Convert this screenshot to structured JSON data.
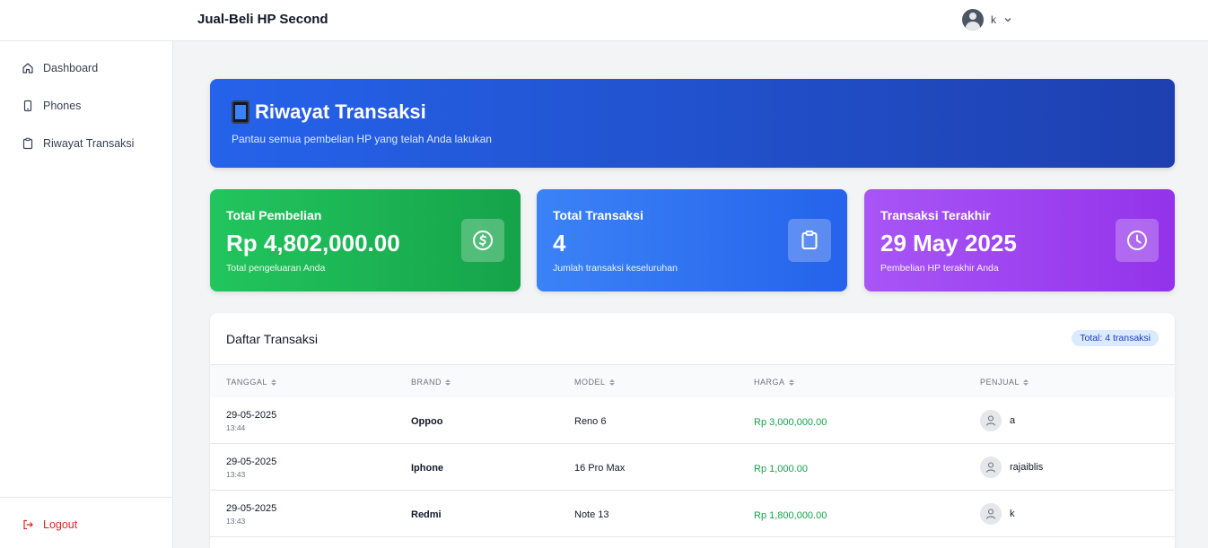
{
  "app": {
    "title": "Jual-Beli HP Second"
  },
  "user": {
    "name": "k"
  },
  "sidebar": {
    "items": [
      {
        "label": "Dashboard",
        "icon": "home-icon"
      },
      {
        "label": "Phones",
        "icon": "phone-icon"
      },
      {
        "label": "Riwayat Transaksi",
        "icon": "clipboard-icon"
      }
    ],
    "logout_label": "Logout"
  },
  "banner": {
    "title": "Riwayat Transaksi",
    "subtitle": "Pantau semua pembelian HP yang telah Anda lakukan"
  },
  "stats": [
    {
      "label": "Total Pembelian",
      "value": "Rp 4,802,000.00",
      "desc": "Total pengeluaran Anda",
      "icon": "dollar-icon",
      "color": "#22c55e"
    },
    {
      "label": "Total Transaksi",
      "value": "4",
      "desc": "Jumlah transaksi keseluruhan",
      "icon": "clipboard-icon",
      "color": "#3b82f6"
    },
    {
      "label": "Transaksi Terakhir",
      "value": "29 May 2025",
      "desc": "Pembelian HP terakhir Anda",
      "icon": "clock-icon",
      "color": "#a855f7"
    }
  ],
  "table": {
    "title": "Daftar Transaksi",
    "badge": "Total: 4 transaksi",
    "columns": [
      "TANGGAL",
      "BRAND",
      "MODEL",
      "HARGA",
      "PENJUAL"
    ],
    "rows": [
      {
        "date": "29-05-2025",
        "time": "13:44",
        "brand": "Oppoo",
        "model": "Reno 6",
        "price": "Rp 3,000,000.00",
        "seller": "a"
      },
      {
        "date": "29-05-2025",
        "time": "13:43",
        "brand": "Iphone",
        "model": "16 Pro Max",
        "price": "Rp 1,000.00",
        "seller": "rajaiblis"
      },
      {
        "date": "29-05-2025",
        "time": "13:43",
        "brand": "Redmi",
        "model": "Note 13",
        "price": "Rp 1,800,000.00",
        "seller": "k"
      }
    ]
  }
}
